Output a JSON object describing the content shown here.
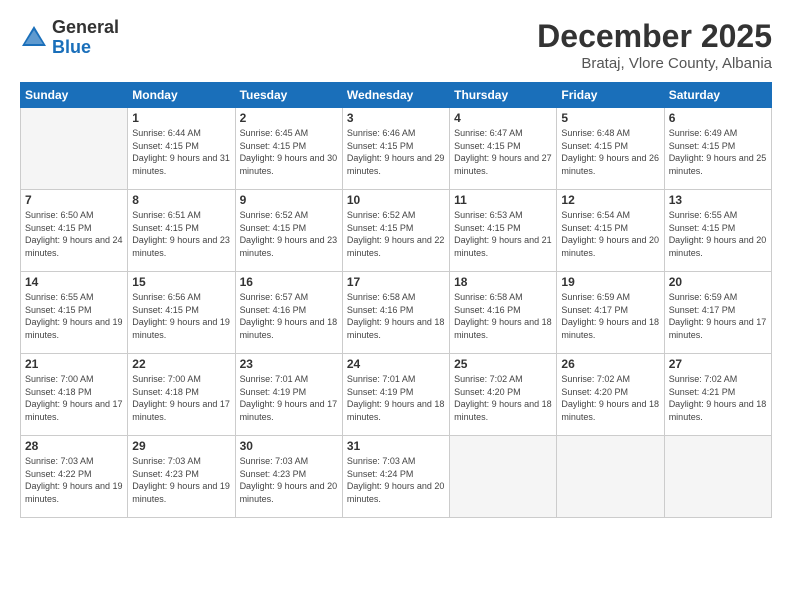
{
  "logo": {
    "general": "General",
    "blue": "Blue"
  },
  "title": "December 2025",
  "location": "Brataj, Vlore County, Albania",
  "days_of_week": [
    "Sunday",
    "Monday",
    "Tuesday",
    "Wednesday",
    "Thursday",
    "Friday",
    "Saturday"
  ],
  "weeks": [
    [
      {
        "day": "",
        "sunrise": "",
        "sunset": "",
        "daylight": "",
        "empty": true
      },
      {
        "day": "1",
        "sunrise": "Sunrise: 6:44 AM",
        "sunset": "Sunset: 4:15 PM",
        "daylight": "Daylight: 9 hours and 31 minutes."
      },
      {
        "day": "2",
        "sunrise": "Sunrise: 6:45 AM",
        "sunset": "Sunset: 4:15 PM",
        "daylight": "Daylight: 9 hours and 30 minutes."
      },
      {
        "day": "3",
        "sunrise": "Sunrise: 6:46 AM",
        "sunset": "Sunset: 4:15 PM",
        "daylight": "Daylight: 9 hours and 29 minutes."
      },
      {
        "day": "4",
        "sunrise": "Sunrise: 6:47 AM",
        "sunset": "Sunset: 4:15 PM",
        "daylight": "Daylight: 9 hours and 27 minutes."
      },
      {
        "day": "5",
        "sunrise": "Sunrise: 6:48 AM",
        "sunset": "Sunset: 4:15 PM",
        "daylight": "Daylight: 9 hours and 26 minutes."
      },
      {
        "day": "6",
        "sunrise": "Sunrise: 6:49 AM",
        "sunset": "Sunset: 4:15 PM",
        "daylight": "Daylight: 9 hours and 25 minutes."
      }
    ],
    [
      {
        "day": "7",
        "sunrise": "Sunrise: 6:50 AM",
        "sunset": "Sunset: 4:15 PM",
        "daylight": "Daylight: 9 hours and 24 minutes."
      },
      {
        "day": "8",
        "sunrise": "Sunrise: 6:51 AM",
        "sunset": "Sunset: 4:15 PM",
        "daylight": "Daylight: 9 hours and 23 minutes."
      },
      {
        "day": "9",
        "sunrise": "Sunrise: 6:52 AM",
        "sunset": "Sunset: 4:15 PM",
        "daylight": "Daylight: 9 hours and 23 minutes."
      },
      {
        "day": "10",
        "sunrise": "Sunrise: 6:52 AM",
        "sunset": "Sunset: 4:15 PM",
        "daylight": "Daylight: 9 hours and 22 minutes."
      },
      {
        "day": "11",
        "sunrise": "Sunrise: 6:53 AM",
        "sunset": "Sunset: 4:15 PM",
        "daylight": "Daylight: 9 hours and 21 minutes."
      },
      {
        "day": "12",
        "sunrise": "Sunrise: 6:54 AM",
        "sunset": "Sunset: 4:15 PM",
        "daylight": "Daylight: 9 hours and 20 minutes."
      },
      {
        "day": "13",
        "sunrise": "Sunrise: 6:55 AM",
        "sunset": "Sunset: 4:15 PM",
        "daylight": "Daylight: 9 hours and 20 minutes."
      }
    ],
    [
      {
        "day": "14",
        "sunrise": "Sunrise: 6:55 AM",
        "sunset": "Sunset: 4:15 PM",
        "daylight": "Daylight: 9 hours and 19 minutes."
      },
      {
        "day": "15",
        "sunrise": "Sunrise: 6:56 AM",
        "sunset": "Sunset: 4:15 PM",
        "daylight": "Daylight: 9 hours and 19 minutes."
      },
      {
        "day": "16",
        "sunrise": "Sunrise: 6:57 AM",
        "sunset": "Sunset: 4:16 PM",
        "daylight": "Daylight: 9 hours and 18 minutes."
      },
      {
        "day": "17",
        "sunrise": "Sunrise: 6:58 AM",
        "sunset": "Sunset: 4:16 PM",
        "daylight": "Daylight: 9 hours and 18 minutes."
      },
      {
        "day": "18",
        "sunrise": "Sunrise: 6:58 AM",
        "sunset": "Sunset: 4:16 PM",
        "daylight": "Daylight: 9 hours and 18 minutes."
      },
      {
        "day": "19",
        "sunrise": "Sunrise: 6:59 AM",
        "sunset": "Sunset: 4:17 PM",
        "daylight": "Daylight: 9 hours and 18 minutes."
      },
      {
        "day": "20",
        "sunrise": "Sunrise: 6:59 AM",
        "sunset": "Sunset: 4:17 PM",
        "daylight": "Daylight: 9 hours and 17 minutes."
      }
    ],
    [
      {
        "day": "21",
        "sunrise": "Sunrise: 7:00 AM",
        "sunset": "Sunset: 4:18 PM",
        "daylight": "Daylight: 9 hours and 17 minutes."
      },
      {
        "day": "22",
        "sunrise": "Sunrise: 7:00 AM",
        "sunset": "Sunset: 4:18 PM",
        "daylight": "Daylight: 9 hours and 17 minutes."
      },
      {
        "day": "23",
        "sunrise": "Sunrise: 7:01 AM",
        "sunset": "Sunset: 4:19 PM",
        "daylight": "Daylight: 9 hours and 17 minutes."
      },
      {
        "day": "24",
        "sunrise": "Sunrise: 7:01 AM",
        "sunset": "Sunset: 4:19 PM",
        "daylight": "Daylight: 9 hours and 18 minutes."
      },
      {
        "day": "25",
        "sunrise": "Sunrise: 7:02 AM",
        "sunset": "Sunset: 4:20 PM",
        "daylight": "Daylight: 9 hours and 18 minutes."
      },
      {
        "day": "26",
        "sunrise": "Sunrise: 7:02 AM",
        "sunset": "Sunset: 4:20 PM",
        "daylight": "Daylight: 9 hours and 18 minutes."
      },
      {
        "day": "27",
        "sunrise": "Sunrise: 7:02 AM",
        "sunset": "Sunset: 4:21 PM",
        "daylight": "Daylight: 9 hours and 18 minutes."
      }
    ],
    [
      {
        "day": "28",
        "sunrise": "Sunrise: 7:03 AM",
        "sunset": "Sunset: 4:22 PM",
        "daylight": "Daylight: 9 hours and 19 minutes."
      },
      {
        "day": "29",
        "sunrise": "Sunrise: 7:03 AM",
        "sunset": "Sunset: 4:23 PM",
        "daylight": "Daylight: 9 hours and 19 minutes."
      },
      {
        "day": "30",
        "sunrise": "Sunrise: 7:03 AM",
        "sunset": "Sunset: 4:23 PM",
        "daylight": "Daylight: 9 hours and 20 minutes."
      },
      {
        "day": "31",
        "sunrise": "Sunrise: 7:03 AM",
        "sunset": "Sunset: 4:24 PM",
        "daylight": "Daylight: 9 hours and 20 minutes."
      },
      {
        "day": "",
        "sunrise": "",
        "sunset": "",
        "daylight": "",
        "empty": true
      },
      {
        "day": "",
        "sunrise": "",
        "sunset": "",
        "daylight": "",
        "empty": true
      },
      {
        "day": "",
        "sunrise": "",
        "sunset": "",
        "daylight": "",
        "empty": true
      }
    ]
  ]
}
